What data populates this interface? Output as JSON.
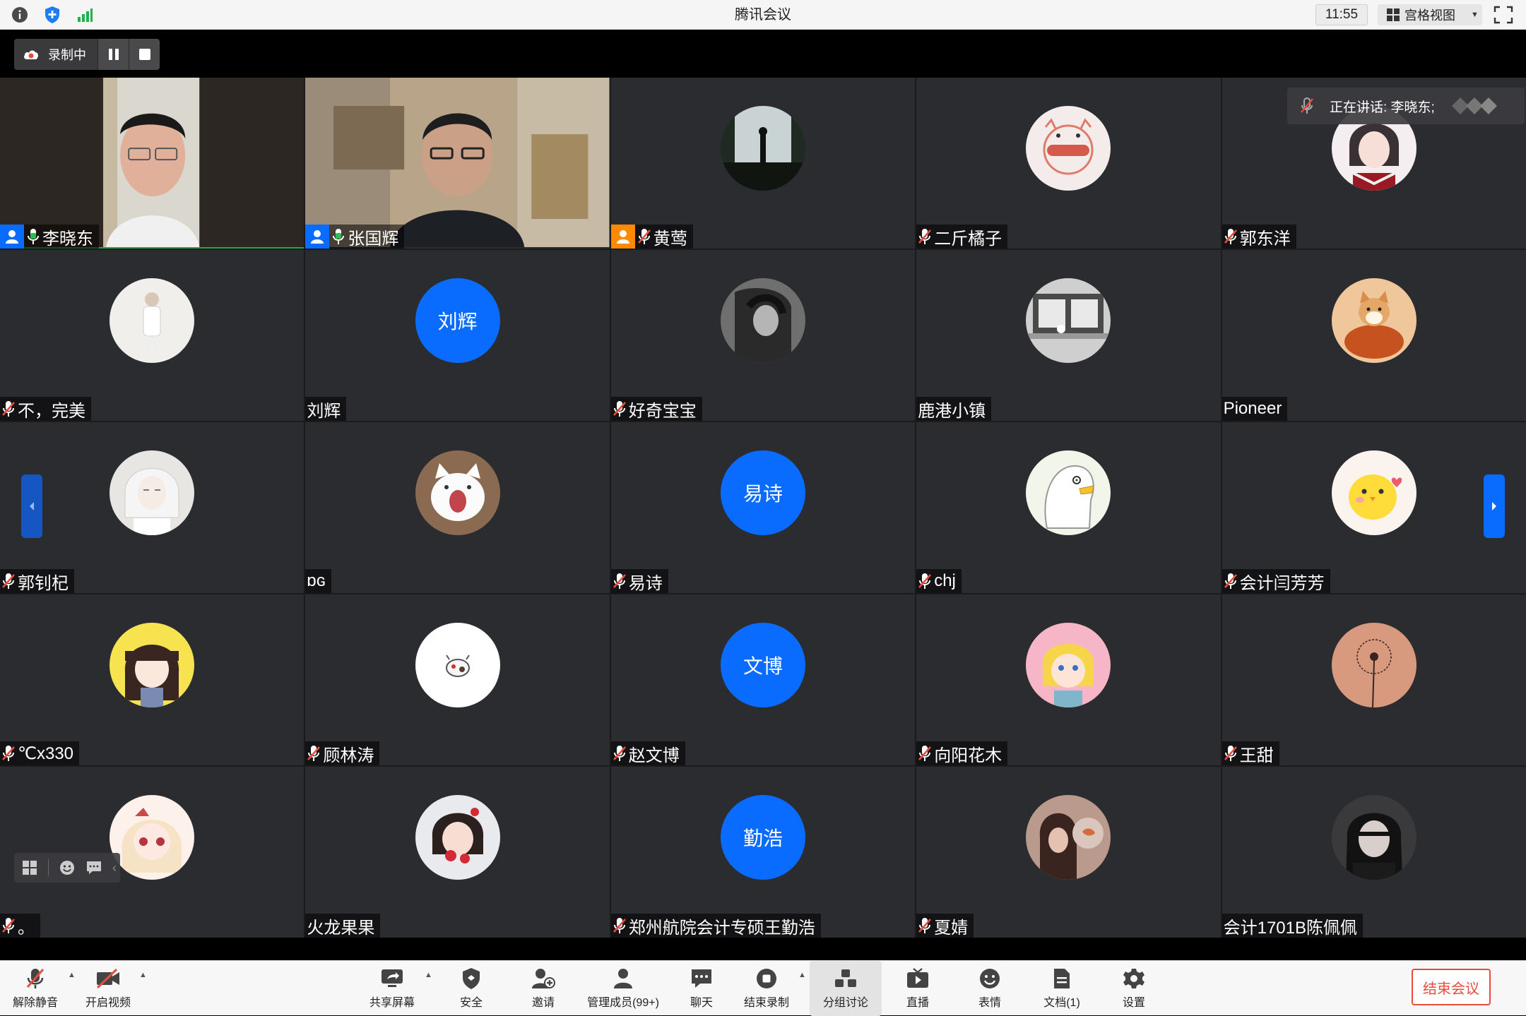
{
  "window": {
    "title": "腾讯会议",
    "time": "11:55",
    "view_mode": "宫格视图"
  },
  "recording": {
    "label": "录制中"
  },
  "speaking": {
    "text": "正在讲话: 李晓东;"
  },
  "participants": [
    {
      "name": "李晓东",
      "type": "video",
      "badge": "host-blue",
      "mic": "on",
      "active": true
    },
    {
      "name": "张国辉",
      "type": "video",
      "badge": "host-blue",
      "mic": "on"
    },
    {
      "name": "黄莺",
      "type": "photo",
      "badge": "host-orange",
      "mic": "muted",
      "avatar": "silhouette-window"
    },
    {
      "name": "二斤橘子",
      "type": "photo",
      "mic": "muted",
      "avatar": "pig-hotdog"
    },
    {
      "name": "郭东洋",
      "type": "photo",
      "mic": "muted",
      "avatar": "anime-boy"
    },
    {
      "name": "不，完美",
      "type": "photo",
      "mic": "muted",
      "avatar": "girl-white"
    },
    {
      "name": "刘辉",
      "type": "text",
      "avatar_text": "刘辉",
      "mic": "none"
    },
    {
      "name": "好奇宝宝",
      "type": "photo",
      "mic": "muted",
      "avatar": "bw-portrait"
    },
    {
      "name": "鹿港小镇",
      "type": "photo",
      "mic": "none",
      "avatar": "window-cat"
    },
    {
      "name": "Pioneer",
      "type": "photo",
      "mic": "none",
      "avatar": "shiba"
    },
    {
      "name": "郭钊杞",
      "type": "photo",
      "mic": "muted",
      "avatar": "anime-white"
    },
    {
      "name": "ɒɢ",
      "type": "photo",
      "mic": "none",
      "avatar": "screaming-cat"
    },
    {
      "name": "易诗",
      "type": "text",
      "avatar_text": "易诗",
      "mic": "muted"
    },
    {
      "name": "chj",
      "type": "photo",
      "mic": "muted",
      "avatar": "white-duck"
    },
    {
      "name": "会计闫芳芳",
      "type": "photo",
      "mic": "muted",
      "avatar": "chick"
    },
    {
      "name": "℃x330",
      "type": "photo",
      "mic": "muted",
      "avatar": "anime-girl-yellow"
    },
    {
      "name": "顾林涛",
      "type": "photo",
      "mic": "muted",
      "avatar": "cow-sticker"
    },
    {
      "name": "赵文博",
      "type": "text",
      "avatar_text": "文博",
      "mic": "muted"
    },
    {
      "name": "向阳花木",
      "type": "photo",
      "mic": "muted",
      "avatar": "cartoon-pink"
    },
    {
      "name": "王甜",
      "type": "photo",
      "mic": "muted",
      "avatar": "dandelion"
    },
    {
      "name": "。",
      "type": "photo",
      "mic": "muted",
      "avatar": "anime-blonde"
    },
    {
      "name": "火龙果果",
      "type": "photo",
      "mic": "none",
      "avatar": "girl-strawberry"
    },
    {
      "name": "郑州航院会计专硕王勤浩",
      "type": "text",
      "avatar_text": "勤浩",
      "mic": "muted"
    },
    {
      "name": "夏婧",
      "type": "photo",
      "mic": "muted",
      "avatar": "girl-fish"
    },
    {
      "name": "会计1701B陈佩佩",
      "type": "photo",
      "mic": "none",
      "avatar": "girl-dark"
    }
  ],
  "toolbar": {
    "unmute": "解除静音",
    "start_video": "开启视频",
    "share_screen": "共享屏幕",
    "security": "安全",
    "invite": "邀请",
    "manage_members": "管理成员(99+)",
    "chat": "聊天",
    "end_recording": "结束录制",
    "breakout": "分组讨论",
    "live": "直播",
    "reactions": "表情",
    "docs": "文档(1)",
    "settings": "设置",
    "end_meeting": "结束会议"
  },
  "colors": {
    "accent": "#0a6cff",
    "host_orange": "#ff8a00",
    "mute_red": "#e84c3d",
    "active_green": "#1fa84a",
    "tile_bg": "#2b2c2f"
  }
}
